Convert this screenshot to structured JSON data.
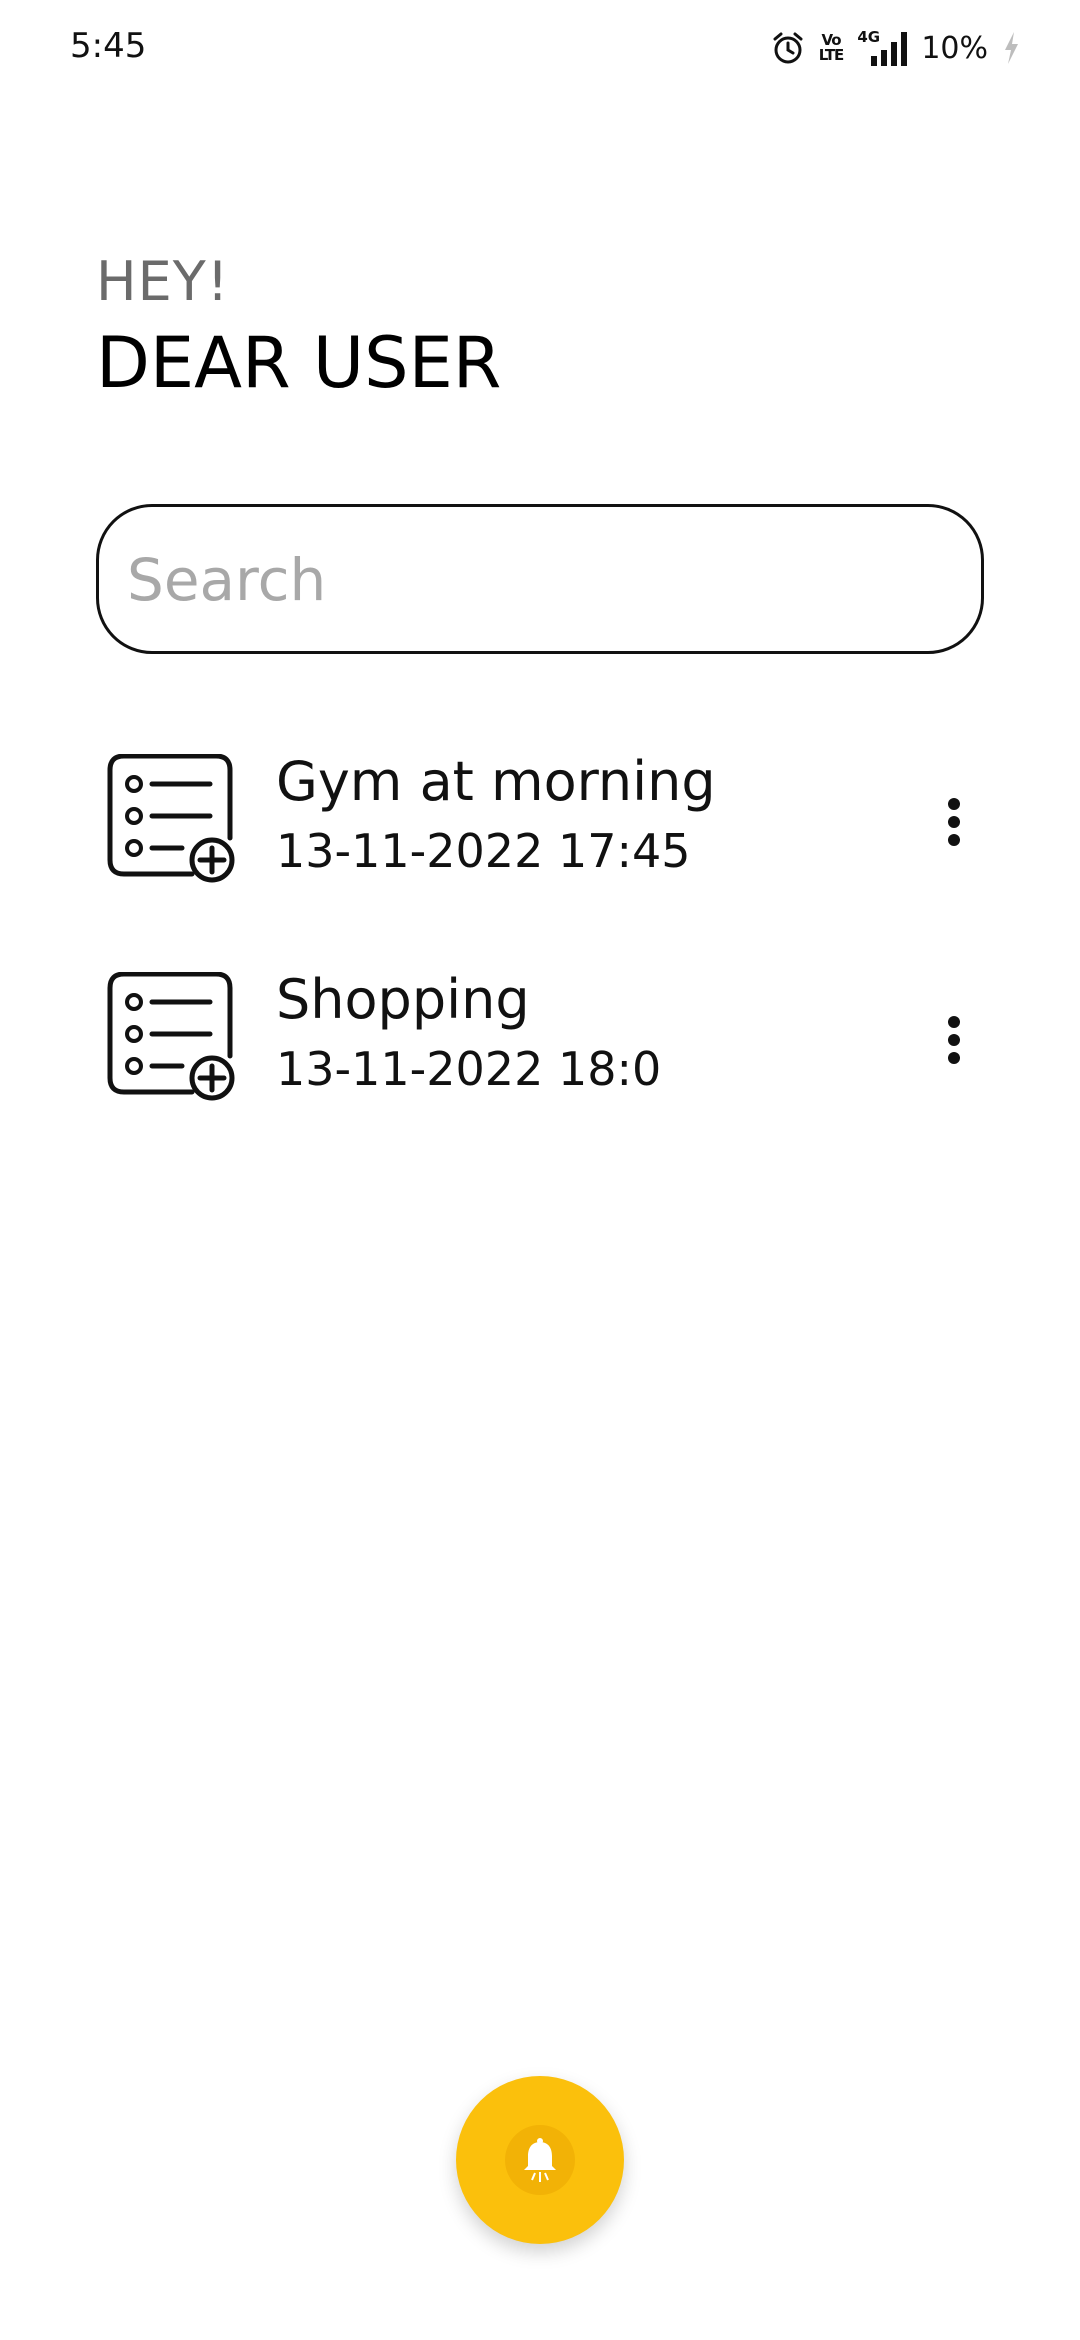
{
  "status_bar": {
    "time": "5:45",
    "volte_top": "Vo",
    "volte_bottom": "LTE",
    "network": "4G",
    "battery": "10%"
  },
  "header": {
    "greeting": "HEY!",
    "name": "DEAR USER"
  },
  "search": {
    "placeholder": "Search",
    "value": ""
  },
  "tasks": [
    {
      "title": "Gym at morning",
      "date": "13-11-2022 17:45",
      "icon": "add-list-icon"
    },
    {
      "title": "Shopping",
      "date": "13-11-2022 18:0",
      "icon": "add-list-icon"
    }
  ],
  "fab": {
    "icon": "bell-icon",
    "color": "#fbc00c"
  }
}
